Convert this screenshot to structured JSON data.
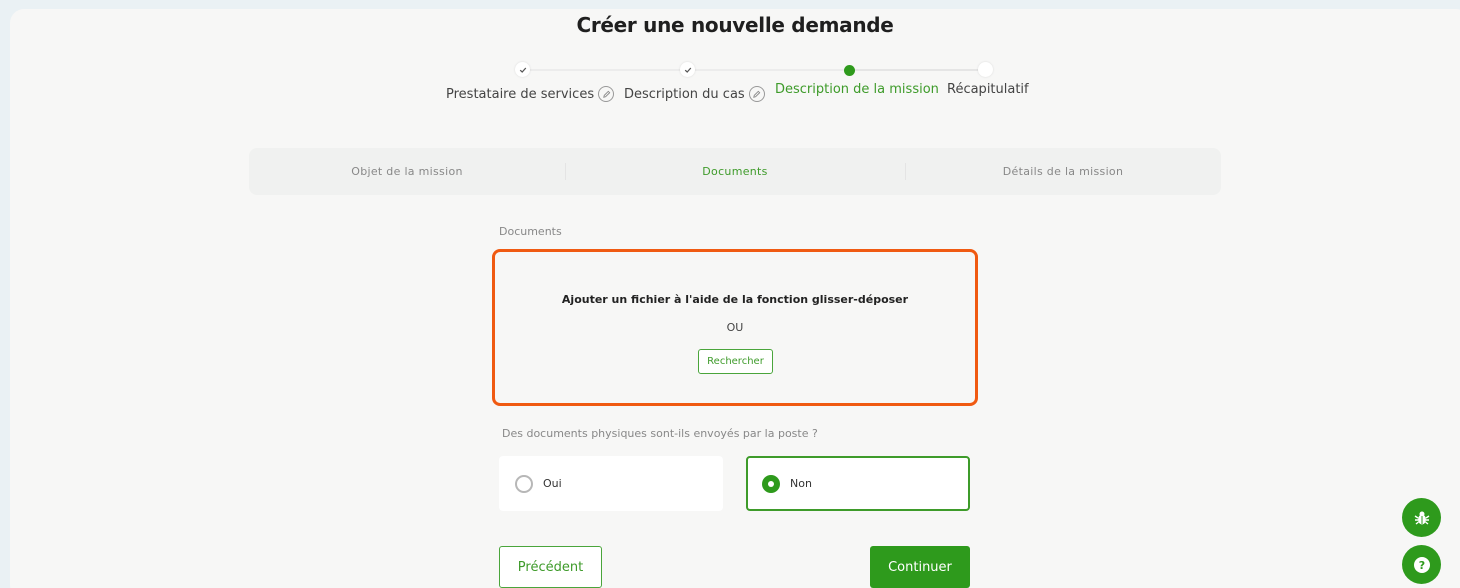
{
  "page": {
    "title": "Créer une nouvelle demande"
  },
  "stepper": {
    "steps": [
      {
        "label": "Prestataire de services",
        "state": "done",
        "editable": true
      },
      {
        "label": "Description du cas",
        "state": "done",
        "editable": true
      },
      {
        "label": "Description de la mission",
        "state": "active",
        "editable": false
      },
      {
        "label": "Récapitulatif",
        "state": "pending",
        "editable": false
      }
    ]
  },
  "subtabs": [
    {
      "label": "Objet de la mission",
      "active": false
    },
    {
      "label": "Documents",
      "active": true
    },
    {
      "label": "Détails de la mission",
      "active": false
    }
  ],
  "documents": {
    "label": "Documents",
    "dropzone_text": "Ajouter un fichier à l'aide de la fonction glisser-déposer",
    "or_text": "OU",
    "browse_label": "Rechercher"
  },
  "physical_docs": {
    "question": "Des documents physiques sont-ils envoyés par la poste ?",
    "options": [
      {
        "label": "Oui",
        "selected": false
      },
      {
        "label": "Non",
        "selected": true
      }
    ]
  },
  "actions": {
    "previous_label": "Précédent",
    "continue_label": "Continuer"
  },
  "floating": {
    "bug_icon": "bug-icon",
    "help_icon": "help-icon"
  },
  "colors": {
    "accent": "#2e9a1c",
    "highlight": "#f05a12"
  }
}
